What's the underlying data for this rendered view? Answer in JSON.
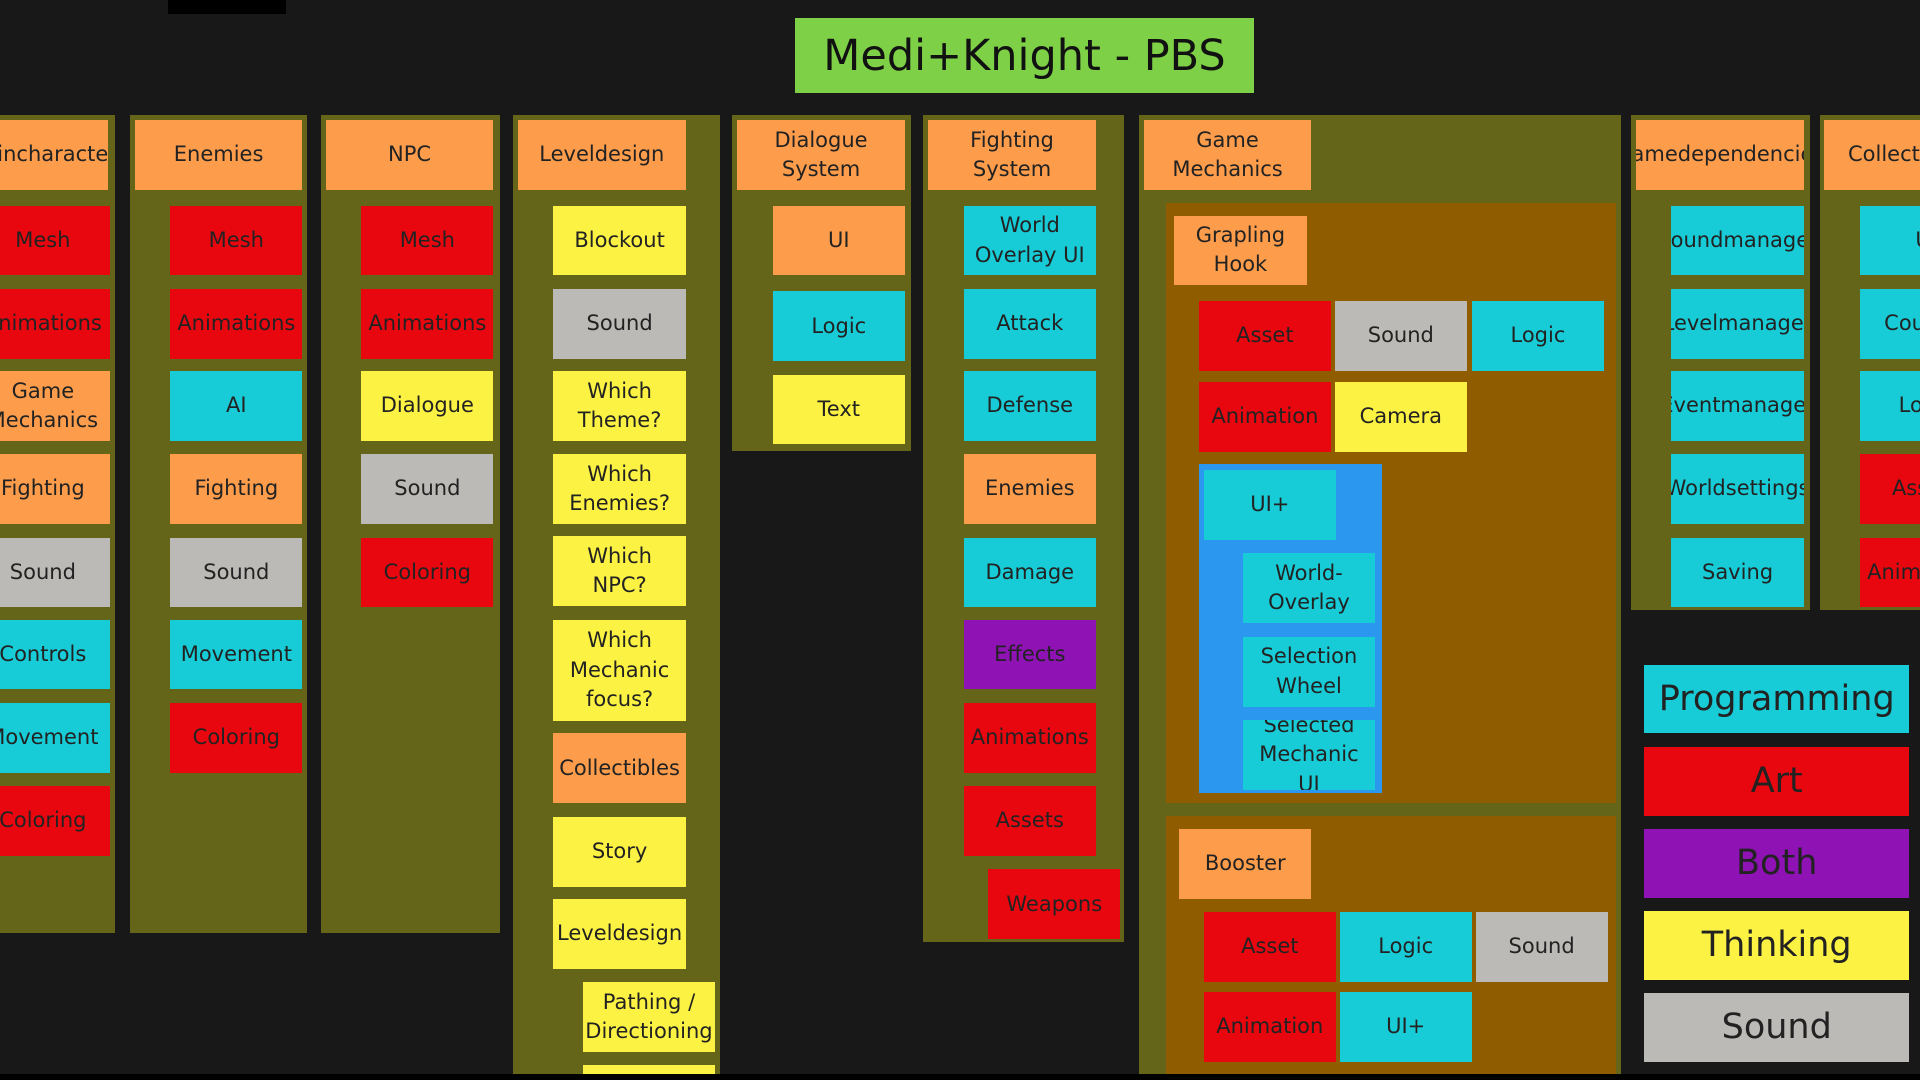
{
  "colors": {
    "orange": "#fd9d4c",
    "red": "#e8070f",
    "cyan": "#17ccd6",
    "yellow": "#fcf243",
    "gray": "#bcbab7",
    "purple": "#8e12b4",
    "title_green": "#7ed047",
    "olive_frame": "#646518",
    "brown_frame": "#8f5d00",
    "blue_frame": "#2b97ee",
    "background": "#181818"
  },
  "title": "Medi+Knight - PBS",
  "columns": [
    {
      "header": "Maincharacter",
      "items": [
        {
          "label": "Mesh",
          "color": "red"
        },
        {
          "label": "Animations",
          "color": "red"
        },
        {
          "label": "Game Mechanics",
          "color": "orange"
        },
        {
          "label": "Fighting",
          "color": "orange"
        },
        {
          "label": "Sound",
          "color": "gray"
        },
        {
          "label": "Controls",
          "color": "cyan"
        },
        {
          "label": "Movement",
          "color": "cyan"
        },
        {
          "label": "Coloring",
          "color": "red"
        }
      ]
    },
    {
      "header": "Enemies",
      "items": [
        {
          "label": "Mesh",
          "color": "red"
        },
        {
          "label": "Animations",
          "color": "red"
        },
        {
          "label": "AI",
          "color": "cyan"
        },
        {
          "label": "Fighting",
          "color": "orange"
        },
        {
          "label": "Sound",
          "color": "gray"
        },
        {
          "label": "Movement",
          "color": "cyan"
        },
        {
          "label": "Coloring",
          "color": "red"
        }
      ]
    },
    {
      "header": "NPC",
      "items": [
        {
          "label": "Mesh",
          "color": "red"
        },
        {
          "label": "Animations",
          "color": "red"
        },
        {
          "label": "Dialogue",
          "color": "yellow"
        },
        {
          "label": "Sound",
          "color": "gray"
        },
        {
          "label": "Coloring",
          "color": "red"
        }
      ]
    },
    {
      "header": "Leveldesign",
      "items": [
        {
          "label": "Blockout",
          "color": "yellow"
        },
        {
          "label": "Sound",
          "color": "gray"
        },
        {
          "label": "Which Theme?",
          "color": "yellow"
        },
        {
          "label": "Which Enemies?",
          "color": "yellow"
        },
        {
          "label": "Which NPC?",
          "color": "yellow"
        },
        {
          "label": "Which Mechanic focus?",
          "color": "yellow"
        },
        {
          "label": "Collectibles",
          "color": "orange"
        },
        {
          "label": "Story",
          "color": "yellow"
        },
        {
          "label": "Leveldesign",
          "color": "yellow"
        },
        {
          "label": "Pathing / Directioning",
          "color": "yellow"
        },
        {
          "label": "",
          "color": "yellow"
        }
      ]
    },
    {
      "header": "Dialogue System",
      "items": [
        {
          "label": "UI",
          "color": "orange"
        },
        {
          "label": "Logic",
          "color": "cyan"
        },
        {
          "label": "Text",
          "color": "yellow"
        }
      ]
    },
    {
      "header": "Fighting System",
      "items": [
        {
          "label": "World Overlay UI",
          "color": "cyan"
        },
        {
          "label": "Attack",
          "color": "cyan"
        },
        {
          "label": "Defense",
          "color": "cyan"
        },
        {
          "label": "Enemies",
          "color": "orange"
        },
        {
          "label": "Damage",
          "color": "cyan"
        },
        {
          "label": "Effects",
          "color": "purple"
        },
        {
          "label": "Animations",
          "color": "red"
        },
        {
          "label": "Assets",
          "color": "red"
        },
        {
          "label": "Weapons",
          "color": "red"
        }
      ]
    },
    {
      "header": "Game Mechanics",
      "groups": [
        {
          "header": "Grapling Hook",
          "items": [
            {
              "label": "Asset",
              "color": "red"
            },
            {
              "label": "Sound",
              "color": "gray"
            },
            {
              "label": "Logic",
              "color": "cyan"
            },
            {
              "label": "Animation",
              "color": "red"
            },
            {
              "label": "Camera",
              "color": "yellow"
            }
          ],
          "sub": {
            "header": "UI+",
            "items": [
              {
                "label": "World-Overlay",
                "color": "cyan"
              },
              {
                "label": "Selection Wheel",
                "color": "cyan"
              },
              {
                "label": "Selected Mechanic UI",
                "color": "cyan"
              }
            ]
          }
        },
        {
          "header": "Booster",
          "items": [
            {
              "label": "Asset",
              "color": "red"
            },
            {
              "label": "Logic",
              "color": "cyan"
            },
            {
              "label": "Sound",
              "color": "gray"
            },
            {
              "label": "Animation",
              "color": "red"
            },
            {
              "label": "UI+",
              "color": "cyan"
            }
          ]
        }
      ]
    },
    {
      "header": "Gamedependencies",
      "items": [
        {
          "label": "Soundmanager",
          "color": "cyan"
        },
        {
          "label": "Levelmanager",
          "color": "cyan"
        },
        {
          "label": "Eventmanager",
          "color": "cyan"
        },
        {
          "label": "Worldsettings",
          "color": "cyan"
        },
        {
          "label": "Saving",
          "color": "cyan"
        }
      ]
    },
    {
      "header": "Collectibles",
      "items": [
        {
          "label": "UI",
          "color": "cyan"
        },
        {
          "label": "Counter",
          "color": "cyan"
        },
        {
          "label": "Logic",
          "color": "cyan"
        },
        {
          "label": "Assets",
          "color": "red"
        },
        {
          "label": "Animations",
          "color": "red"
        }
      ]
    }
  ],
  "legend": [
    {
      "label": "Programming",
      "color": "cyan"
    },
    {
      "label": "Art",
      "color": "red"
    },
    {
      "label": "Both",
      "color": "purple"
    },
    {
      "label": "Thinking",
      "color": "yellow"
    },
    {
      "label": "Sound",
      "color": "gray"
    }
  ]
}
